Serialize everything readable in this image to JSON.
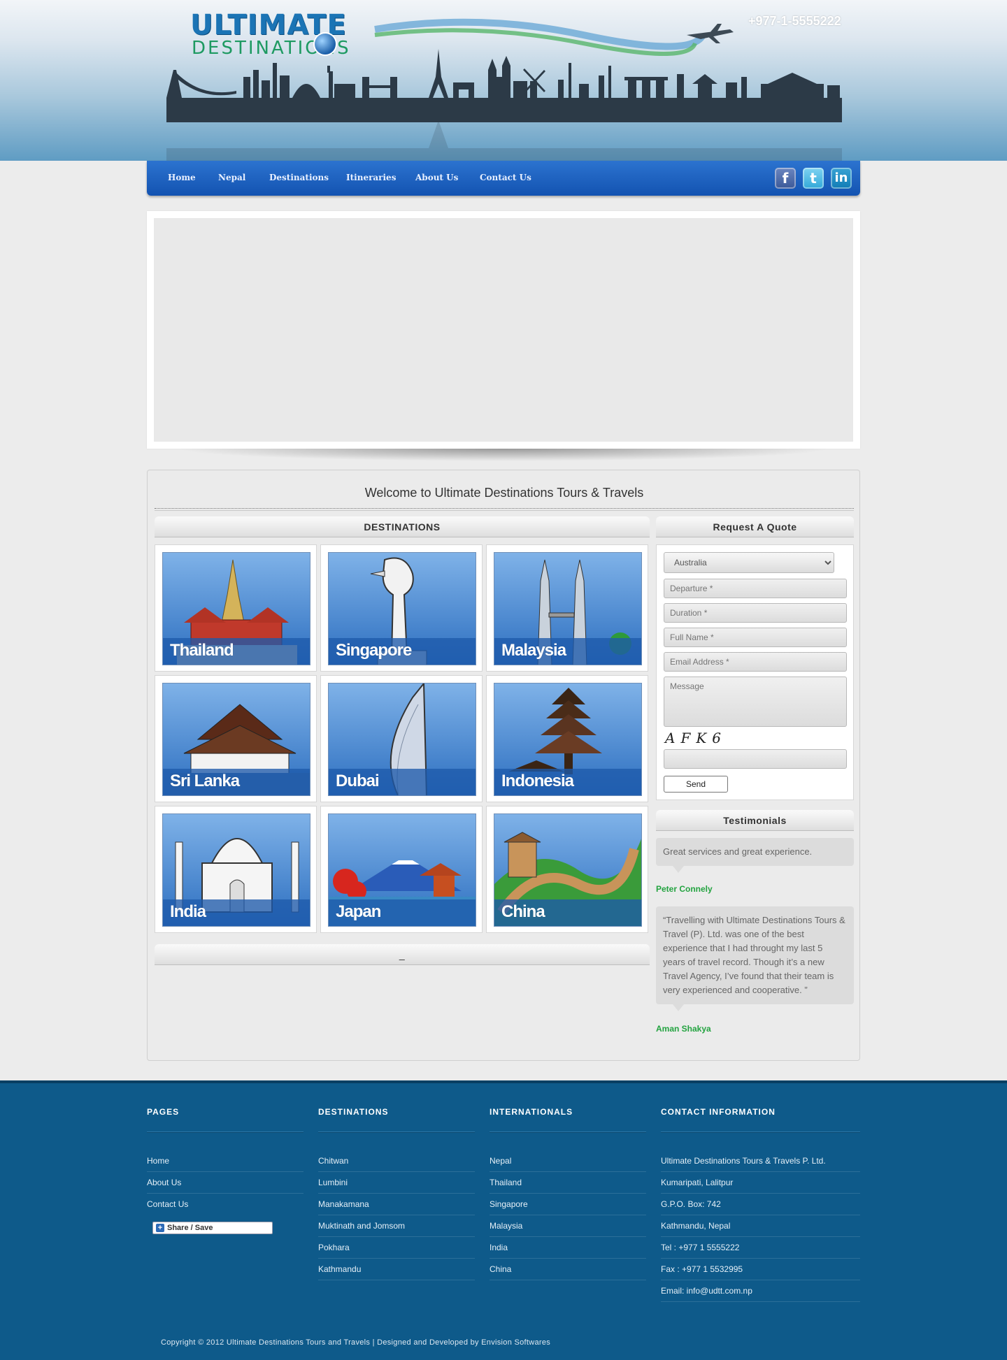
{
  "header": {
    "logo_line1": "ULTIMATE",
    "logo_line2": "DESTINATIONS",
    "phone": "+977-1-5555222"
  },
  "nav": {
    "items": [
      "Home",
      "Nepal",
      "Destinations",
      "Itineraries",
      "About Us",
      "Contact Us"
    ],
    "social": [
      "facebook-icon",
      "twitter-icon",
      "linkedin-icon"
    ],
    "social_glyphs": [
      "f",
      "t",
      "in"
    ]
  },
  "main": {
    "welcome": "Welcome to Ultimate Destinations Tours & Travels",
    "destinations_header": "DESTINATIONS",
    "bottom_bar": "_",
    "destinations": [
      {
        "name": "Thailand"
      },
      {
        "name": "Singapore"
      },
      {
        "name": "Malaysia"
      },
      {
        "name": "Sri Lanka"
      },
      {
        "name": "Dubai"
      },
      {
        "name": "Indonesia"
      },
      {
        "name": "India"
      },
      {
        "name": "Japan"
      },
      {
        "name": "China"
      }
    ]
  },
  "quote": {
    "header": "Request A Quote",
    "country_selected": "Australia",
    "departure_placeholder": "Departure *",
    "duration_placeholder": "Duration *",
    "fullname_placeholder": "Full Name *",
    "email_placeholder": "Email Address *",
    "message_placeholder": "Message",
    "captcha": "AFK6",
    "send_label": "Send"
  },
  "testimonials": {
    "header": "Testimonials",
    "items": [
      {
        "text": "Great services and great experience.",
        "author": "Peter Connely"
      },
      {
        "text": "“Travelling with Ultimate Destinations Tours & Travel (P). Ltd. was one of the best experience that I had throught my last 5 years of travel record. Though it’s a new Travel Agency, I’ve found that their team is very experienced and cooperative. ”",
        "author": "Aman Shakya"
      }
    ]
  },
  "footer": {
    "pages": {
      "title": "PAGES",
      "links": [
        "Home",
        "About Us",
        "Contact Us"
      ]
    },
    "destinations": {
      "title": "DESTINATIONS",
      "links": [
        "Chitwan",
        "Lumbini",
        "Manakamana",
        "Muktinath and Jomsom",
        "Pokhara",
        "Kathmandu"
      ]
    },
    "internationals": {
      "title": "INTERNATIONALS",
      "links": [
        "Nepal",
        "Thailand",
        "Singapore",
        "Malaysia",
        "India",
        "China"
      ]
    },
    "contact": {
      "title": "CONTACT INFORMATION",
      "links": [
        "Ultimate Destinations Tours & Travels P. Ltd.",
        "Kumaripati, Lalitpur",
        "G.P.O. Box: 742",
        "Kathmandu, Nepal",
        "Tel : +977 1 5555222",
        "Fax : +977 1 5532995",
        "Email: info@udtt.com.np"
      ]
    },
    "share_label": "Share / Save",
    "copyright": "Copyright © 2012 Ultimate Destinations Tours and Travels | Designed and Developed by Envision Softwares"
  },
  "colors": {
    "nav_blue": "#1a5fbf",
    "footer_blue": "#0e5a8a",
    "testimonial_name_green": "#23a340",
    "logo_blue": "#1b74b5",
    "logo_green": "#1e9a62"
  }
}
